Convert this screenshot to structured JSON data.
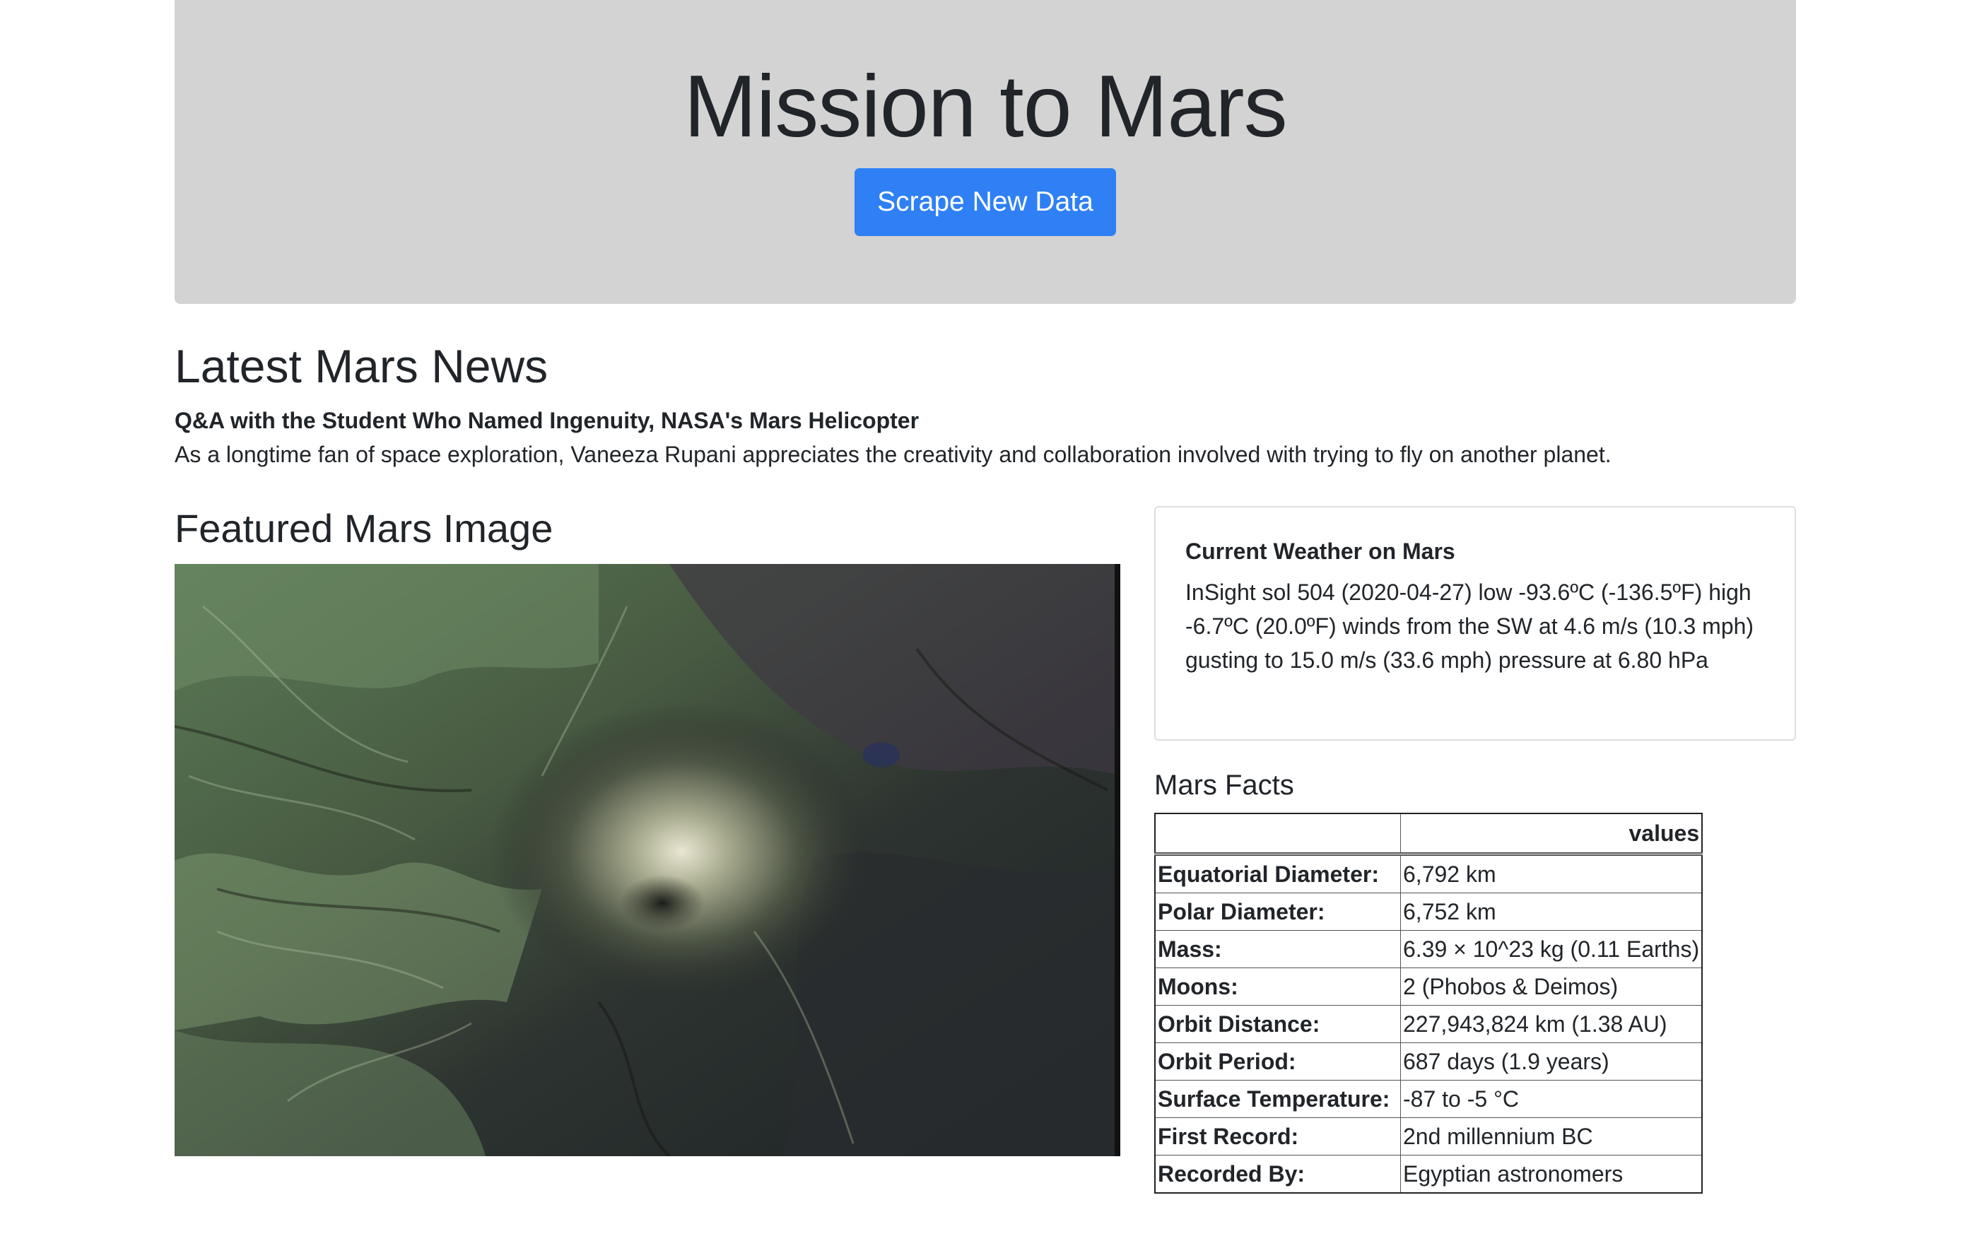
{
  "header": {
    "title": "Mission to Mars",
    "scrape_button_label": "Scrape New Data",
    "background_color": "#d3d3d3",
    "button_color": "#2f80f4"
  },
  "news": {
    "heading": "Latest Mars News",
    "title": "Q&A with the Student Who Named Ingenuity, NASA's Mars Helicopter",
    "paragraph": "As a longtime fan of space exploration, Vaneeza Rupani appreciates the creativity and collaboration involved with trying to fly on another planet."
  },
  "featured": {
    "heading": "Featured Mars Image"
  },
  "weather": {
    "title": "Current Weather on Mars",
    "text": "InSight sol 504 (2020-04-27) low -93.6ºC (-136.5ºF) high -6.7ºC (20.0ºF) winds from the SW at 4.6 m/s (10.3 mph) gusting to 15.0 m/s (33.6 mph) pressure at 6.80 hPa"
  },
  "facts": {
    "heading": "Mars Facts",
    "header_label": "",
    "header_value": "values",
    "rows": [
      {
        "label": "Equatorial Diameter:",
        "value": "6,792 km"
      },
      {
        "label": "Polar Diameter:",
        "value": "6,752 km"
      },
      {
        "label": "Mass:",
        "value": "6.39 × 10^23 kg (0.11 Earths)"
      },
      {
        "label": "Moons:",
        "value": "2 (Phobos & Deimos)"
      },
      {
        "label": "Orbit Distance:",
        "value": "227,943,824 km (1.38 AU)"
      },
      {
        "label": "Orbit Period:",
        "value": "687 days (1.9 years)"
      },
      {
        "label": "Surface Temperature:",
        "value": "-87 to -5 °C"
      },
      {
        "label": "First Record:",
        "value": "2nd millennium BC"
      },
      {
        "label": "Recorded By:",
        "value": "Egyptian astronomers"
      }
    ]
  }
}
